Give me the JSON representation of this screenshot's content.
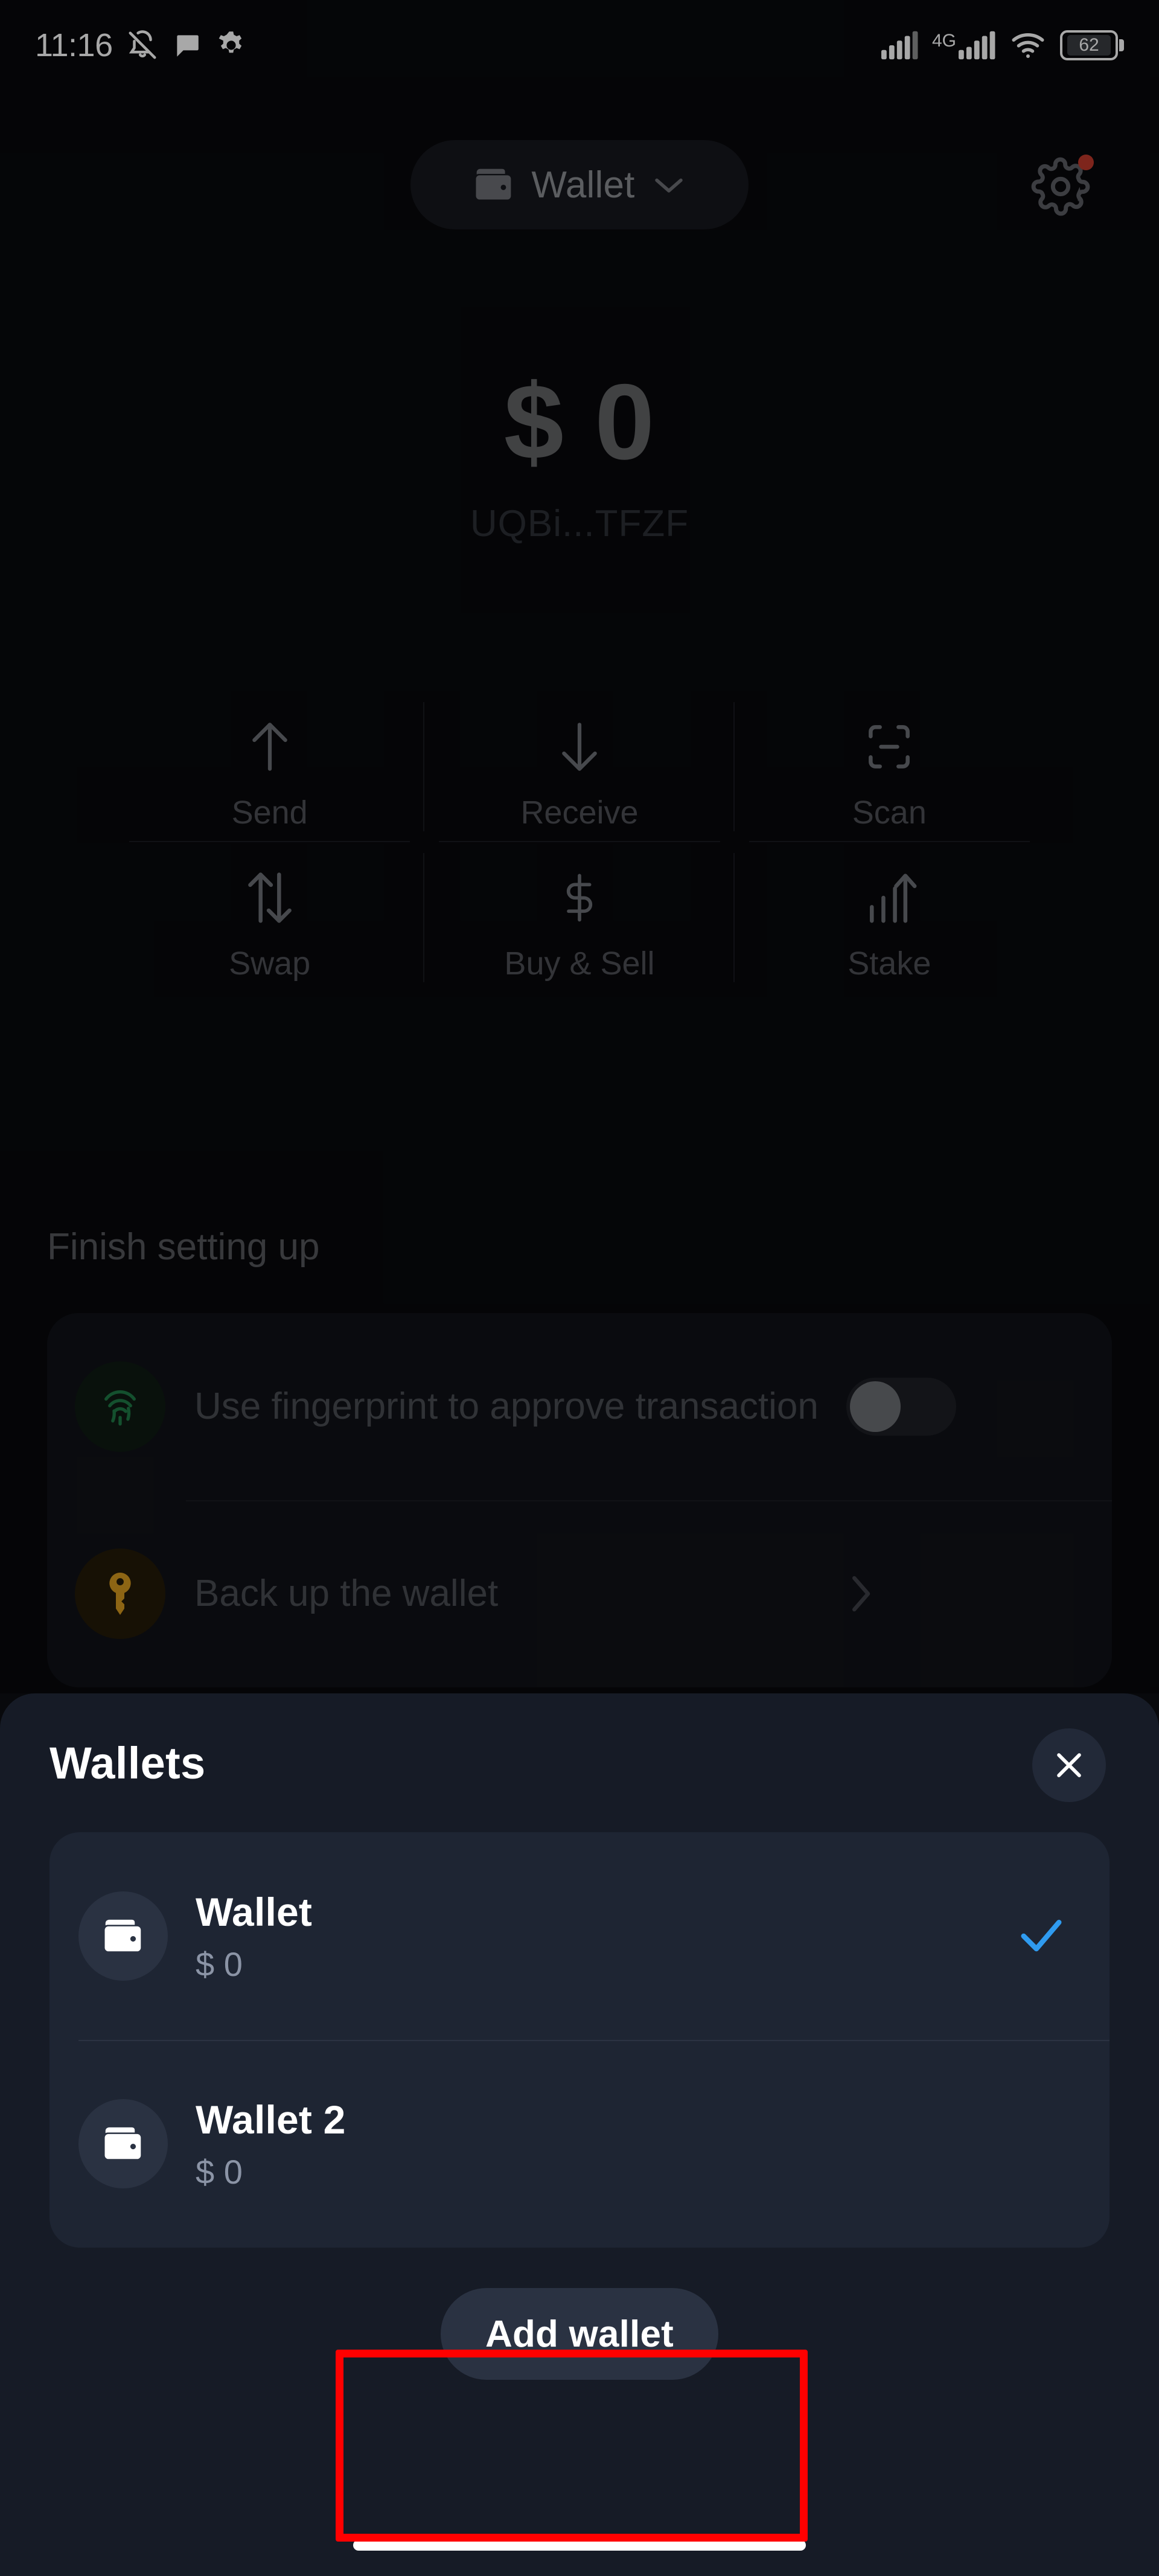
{
  "status_bar": {
    "time": "11:16",
    "left_icons": [
      "bell-off-icon",
      "chat-bubble-icon",
      "gear-icon"
    ],
    "right_icons": [
      "signal-bars-icon",
      "network-4g-icon",
      "signal-bars-2-icon",
      "wifi-icon",
      "battery-icon"
    ],
    "network_label": "4G",
    "battery_level": "62"
  },
  "header": {
    "wallet_selector_label": "Wallet",
    "wallet_icon": "wallet-icon",
    "chevron_icon": "chevron-down-icon",
    "settings_icon": "gear-icon",
    "settings_badge": true
  },
  "balance": {
    "amount": "$ 0",
    "address": "UQBi...TFZF"
  },
  "actions": [
    {
      "label": "Send",
      "icon": "arrow-up-icon"
    },
    {
      "label": "Receive",
      "icon": "arrow-down-icon"
    },
    {
      "label": "Scan",
      "icon": "scan-frame-icon"
    },
    {
      "label": "Swap",
      "icon": "swap-arrows-icon"
    },
    {
      "label": "Buy & Sell",
      "icon": "dollar-sign-icon"
    },
    {
      "label": "Stake",
      "icon": "chart-arrow-up-icon"
    }
  ],
  "setup": {
    "title": "Finish setting up",
    "rows": [
      {
        "text": "Use fingerprint to approve transaction",
        "icon": "fingerprint-icon",
        "icon_color": "#1f6b3e",
        "control": "toggle",
        "toggle_on": false
      },
      {
        "text": "Back up the wallet",
        "icon": "key-icon",
        "icon_color": "#d79a1f",
        "control": "chevron",
        "chevron_icon": "chevron-right-icon"
      }
    ]
  },
  "sheet": {
    "title": "Wallets",
    "close_icon": "close-icon",
    "wallets": [
      {
        "name": "Wallet",
        "balance": "$ 0",
        "icon": "wallet-icon",
        "selected": true,
        "check_icon": "check-icon"
      },
      {
        "name": "Wallet 2",
        "balance": "$ 0",
        "icon": "wallet-icon",
        "selected": false
      }
    ],
    "add_wallet_label": "Add wallet"
  },
  "annotation": {
    "highlight_color": "#ff0000",
    "target": "Add wallet"
  },
  "colors": {
    "background": "#08090c",
    "sheet_background": "#161b26",
    "list_background": "#1e2533",
    "accent_check": "#2f9bf0",
    "muted_text": "#4e5055",
    "white": "#ffffff"
  }
}
